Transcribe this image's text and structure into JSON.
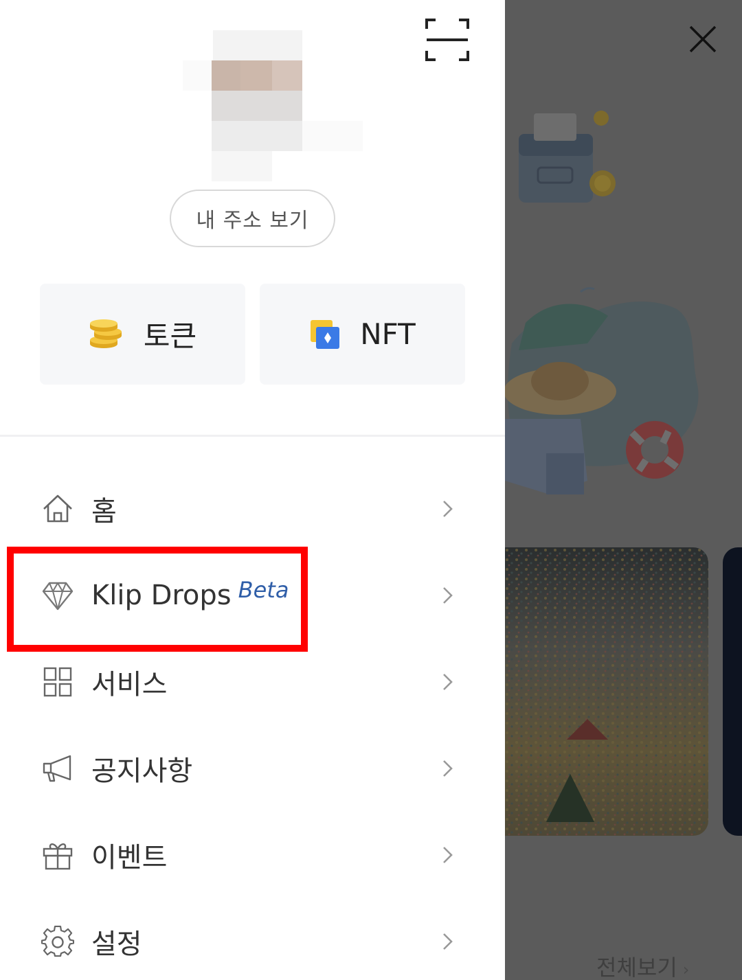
{
  "header": {
    "scan_icon": "qr-scan-icon",
    "view_address_label": "내 주소 보기"
  },
  "assets": [
    {
      "label": "토큰",
      "icon": "coins-icon"
    },
    {
      "label": "NFT",
      "icon": "nft-card-icon"
    }
  ],
  "menu": {
    "items": [
      {
        "label": "홈",
        "icon": "home-icon"
      },
      {
        "label": "Klip Drops",
        "badge": "Beta",
        "icon": "diamond-icon"
      },
      {
        "label": "서비스",
        "icon": "grid-icon"
      },
      {
        "label": "공지사항",
        "icon": "megaphone-icon"
      },
      {
        "label": "이벤트",
        "icon": "gift-icon"
      },
      {
        "label": "설정",
        "icon": "gear-icon"
      }
    ]
  },
  "background": {
    "close_icon": "close-icon",
    "view_all_label": "전체보기"
  },
  "colors": {
    "highlight": "#ff0000",
    "beta": "#2f5ea8",
    "overlay": "#5b5b5b"
  }
}
